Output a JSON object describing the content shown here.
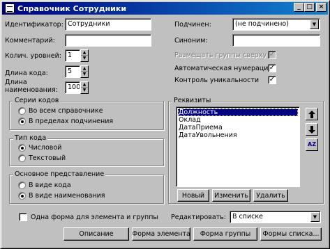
{
  "window": {
    "title": "Справочник Сотрудники",
    "buttons": {
      "minimize": "_",
      "maximize": "□",
      "close": "×"
    }
  },
  "left": {
    "identifier_label": "Идентификатор:",
    "identifier_value": "Сотрудники",
    "comment_label": "Комментарий:",
    "comment_value": "",
    "levels_label": "Колич. уровней:",
    "levels_value": "1",
    "code_length_label": "Длина кода:",
    "code_length_value": "5",
    "name_length_label_1": "Длина",
    "name_length_label_2": "наименования:",
    "name_length_value": "100"
  },
  "right": {
    "subordinate_label": "Подчинен:",
    "subordinate_value": "(не подчинено)",
    "synonym_label": "Синоним:",
    "synonym_value": "",
    "groups_top_label": "Размещать группы сверху",
    "groups_top_checked": true,
    "auto_number_label": "Автоматическая нумерация",
    "auto_number_checked": true,
    "unique_control_label": "Контроль уникальности",
    "unique_control_checked": true
  },
  "code_series": {
    "title": "Серии кодов",
    "options": [
      "Во всем справочнике",
      "В пределах подчинения"
    ],
    "selected": 1
  },
  "code_type": {
    "title": "Тип кода",
    "options": [
      "Числовой",
      "Текстовый"
    ],
    "selected": 0
  },
  "main_view": {
    "title": "Основное представление",
    "options": [
      "В виде кода",
      "В виде наименования"
    ],
    "selected": 1
  },
  "attributes": {
    "title": "Реквизиты",
    "items": [
      "Должность",
      "Оклад",
      "ДатаПриема",
      "ДатаУвольнения"
    ],
    "selected": 0,
    "new_button": "Новый",
    "edit_button": "Изменить",
    "delete_button": "Удалить",
    "sort_button": "AZ"
  },
  "bottom": {
    "one_form_label": "Одна форма для элемента и группы",
    "one_form_checked": false,
    "edit_label": "Редактировать:",
    "edit_value": "В списке",
    "description_button": "Описание",
    "element_form_button": "Форма элемента",
    "group_form_button": "Форма группы",
    "list_forms_button": "Формы списка..."
  }
}
